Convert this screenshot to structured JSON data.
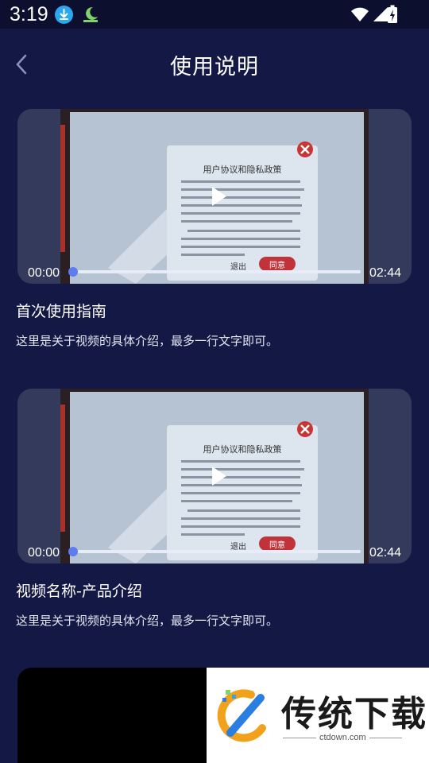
{
  "status_bar": {
    "time": "3:19"
  },
  "header": {
    "title": "使用说明"
  },
  "videos": [
    {
      "title": "首次使用指南",
      "description": "这里是关于视频的具体介绍，最多一行文字即可。",
      "current_time": "00:00",
      "total_time": "02:44",
      "progress": 0
    },
    {
      "title": "视频名称-产品介绍",
      "description": "这里是关于视频的具体介绍，最多一行文字即可。",
      "current_time": "00:00",
      "total_time": "02:44",
      "progress": 0
    }
  ],
  "thumbnail_text": {
    "dialog_title": "用户协议和隐私政策",
    "exit_label": "退出",
    "agree_label": "同意"
  },
  "watermark": {
    "brand": "传统下载",
    "url": "ctdown.com"
  },
  "colors": {
    "background": "#141845",
    "status_bar": "#0c0f2e",
    "progress_thumb": "#5d7bf2",
    "download_badge": "#2aa7ee"
  }
}
